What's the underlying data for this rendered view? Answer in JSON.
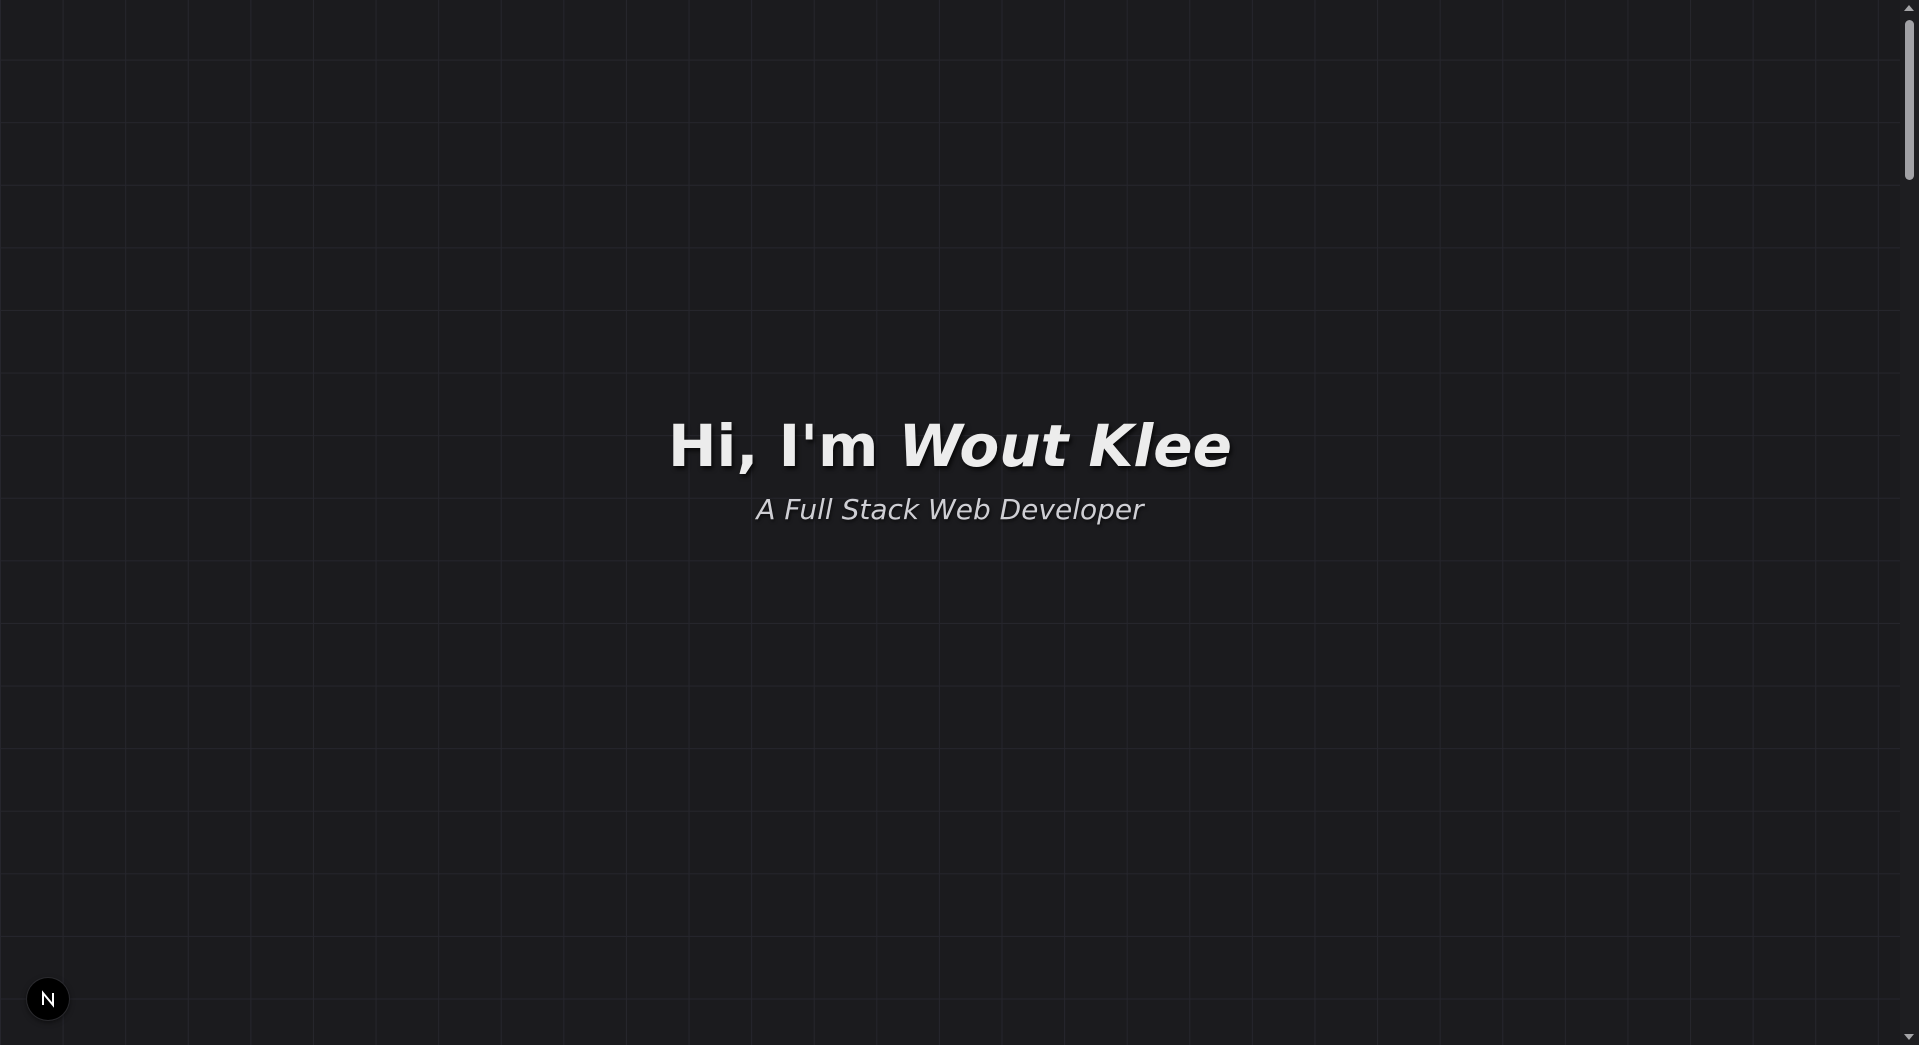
{
  "hero": {
    "greeting": "Hi, I'm ",
    "name": "Wout Klee",
    "subtitle": "A Full Stack Web Developer"
  },
  "dev_indicator": {
    "icon": "nextjs-logo-icon"
  },
  "colors": {
    "background": "#1b1b1e",
    "grid_line": "#26262d",
    "title": "#ececec",
    "subtitle": "#cfcfd4"
  }
}
